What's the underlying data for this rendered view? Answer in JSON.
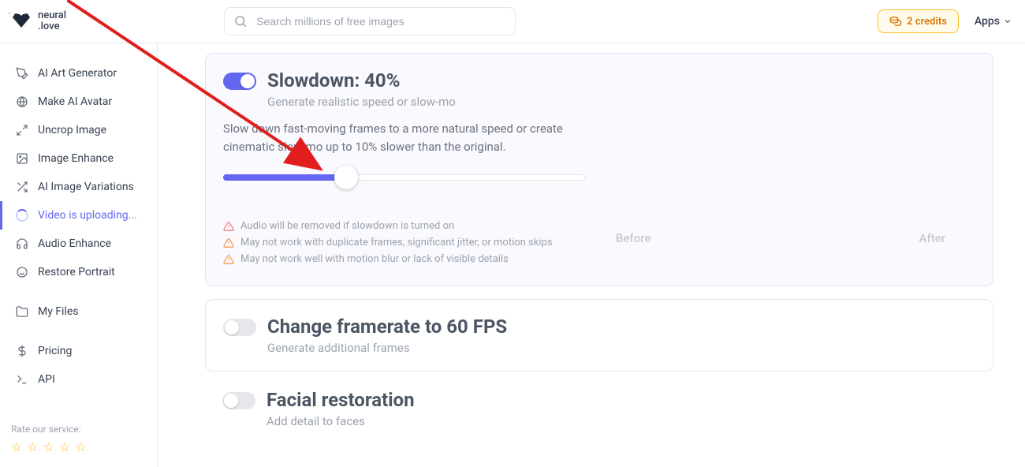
{
  "logo": {
    "line1": "neural",
    "line2": ".love"
  },
  "search": {
    "placeholder": "Search millions of free images"
  },
  "header": {
    "credits": "2 credits",
    "apps": "Apps"
  },
  "sidebar": {
    "items": [
      {
        "label": "AI Art Generator"
      },
      {
        "label": "Make AI Avatar"
      },
      {
        "label": "Uncrop Image"
      },
      {
        "label": "Image Enhance"
      },
      {
        "label": "AI Image Variations"
      },
      {
        "label": "Video is uploading..."
      },
      {
        "label": "Audio Enhance"
      },
      {
        "label": "Restore Portrait"
      },
      {
        "label": "My Files"
      },
      {
        "label": "Pricing"
      },
      {
        "label": "API"
      }
    ],
    "rate_label": "Rate our service:"
  },
  "slowdown": {
    "title": "Slowdown: 40%",
    "subtitle": "Generate realistic speed or slow-mo",
    "desc": "Slow down fast-moving frames to a more natural speed or create cinematic slow-mo up to 10% slower than the original.",
    "slider_percent": 34,
    "warnings": [
      "Audio will be removed if slowdown is turned on",
      "May not work with duplicate frames, significant jitter, or motion skips",
      "May not work well with motion blur or lack of visible details"
    ],
    "before": "Before",
    "after": "After"
  },
  "framerate": {
    "title": "Change framerate to 60 FPS",
    "subtitle": "Generate additional frames"
  },
  "facial": {
    "title": "Facial restoration",
    "subtitle": "Add detail to faces"
  },
  "colors": {
    "accent": "#6366f1",
    "amber": "#d97706"
  }
}
